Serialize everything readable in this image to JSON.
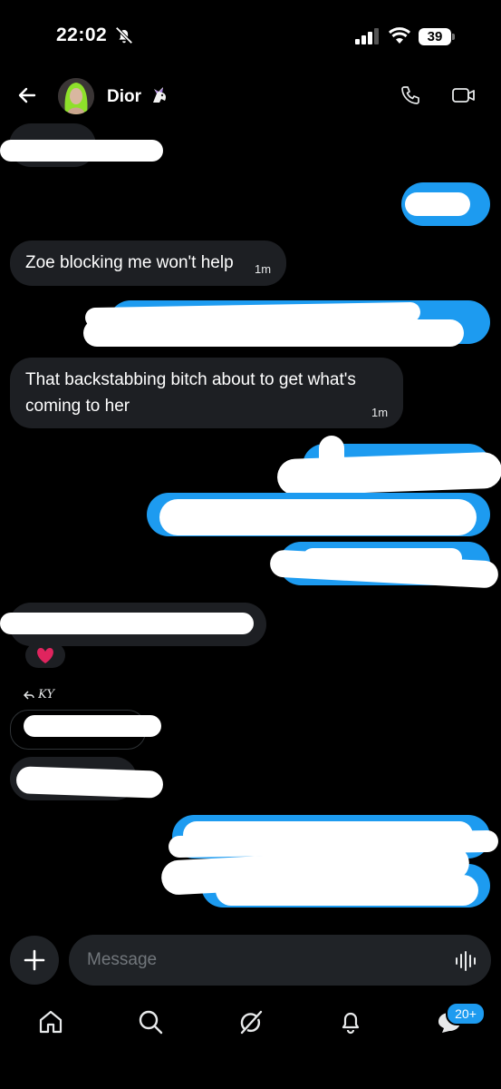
{
  "status_bar": {
    "time": "22:02",
    "battery": "39"
  },
  "header": {
    "contact_name": "Dior",
    "emoji": "unicorn"
  },
  "messages": [
    {
      "direction": "incoming",
      "text": "Zoe blocking me won't help",
      "time": "1m"
    },
    {
      "direction": "incoming",
      "text": "That backstabbing bitch about to get what's coming to her",
      "time": "1m"
    }
  ],
  "reaction": "heart",
  "reply_to": "KY",
  "composer": {
    "placeholder": "Message"
  },
  "bottom_nav": {
    "messages_badge": "20+"
  },
  "icons": [
    "back-arrow-icon",
    "phone-icon",
    "video-icon",
    "plus-icon",
    "voice-icon",
    "home-icon",
    "search-icon",
    "grok-icon",
    "bell-icon",
    "messages-icon"
  ],
  "colors": {
    "outgoing_bubble": "#1d9bf0",
    "incoming_bubble": "#1d1f23",
    "background": "#000000"
  }
}
